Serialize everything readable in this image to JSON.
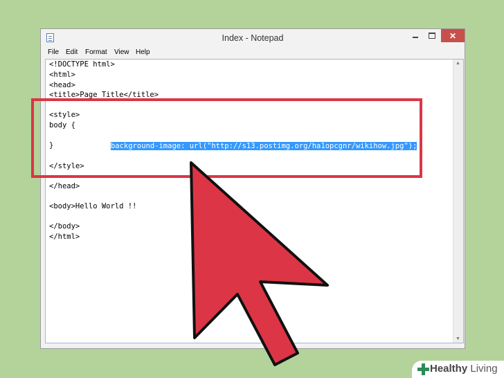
{
  "window": {
    "title": "Index - Notepad"
  },
  "menu": [
    "File",
    "Edit",
    "Format",
    "View",
    "Help"
  ],
  "editor": {
    "lines": [
      "<!DOCTYPE html>",
      "<html>",
      "<head>",
      "<title>Page Title</title>",
      "",
      "<style>",
      "body {",
      "        background-image: url(\"http://s13.postimg.org/ha1opcgnr/wikihow.jpg\");",
      "}",
      "",
      "</style>",
      "",
      "</head>",
      "",
      "<body>Hello World !!",
      "",
      "</body>",
      "</html>"
    ],
    "selected_line_index": 7,
    "selected_text": "background-image: url(\"http://s13.postimg.org/ha1opcgnr/wikihow.jpg\");"
  },
  "colors": {
    "background": "#b3d39b",
    "highlight_border": "#dc3545",
    "arrow_fill": "#dc3545",
    "selection": "#3399ff",
    "close_button": "#c7504a",
    "watermark_icon": "#2e8b57"
  },
  "icons": {
    "app": "notepad-icon",
    "minimize": "minimize-icon",
    "maximize": "maximize-icon",
    "close": "close-icon",
    "cursor": "arrow-cursor-icon",
    "watermark": "plus-logo-icon"
  },
  "watermark": {
    "bold": "Healthy",
    "light": " Living"
  }
}
